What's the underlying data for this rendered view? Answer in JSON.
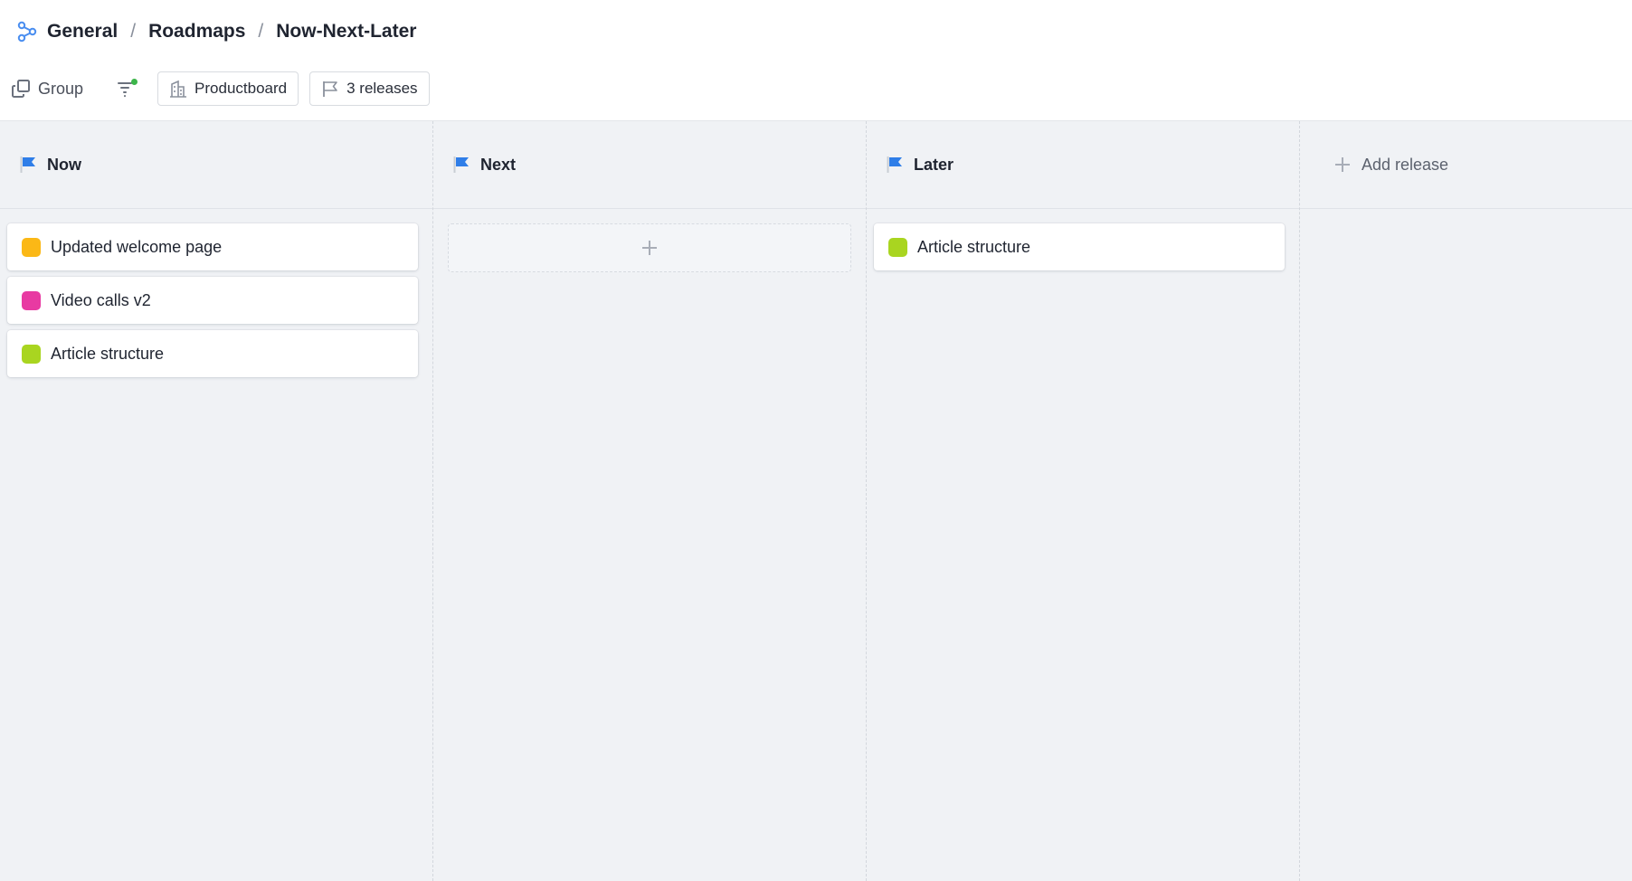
{
  "breadcrumb": {
    "items": [
      "General",
      "Roadmaps",
      "Now-Next-Later"
    ],
    "separator": "/",
    "logo_icon": "hierarchy-icon"
  },
  "toolbar": {
    "group_label": "Group",
    "group_icon": "group-icon",
    "filter_icon": "filter-icon",
    "filter_active_color": "#3cb54a",
    "workspace_label": "Productboard",
    "workspace_icon": "building-icon",
    "releases_label": "3 releases",
    "releases_icon": "flag-outline-icon"
  },
  "colors": {
    "flag": "#2f7ee8",
    "board_bg": "#f0f2f5"
  },
  "columns": [
    {
      "title": "Now",
      "cards": [
        {
          "label": "Updated welcome page",
          "color": "#fbb816"
        },
        {
          "label": "Video calls v2",
          "color": "#e83aa2"
        },
        {
          "label": "Article structure",
          "color": "#a9d520"
        }
      ]
    },
    {
      "title": "Next",
      "cards": []
    },
    {
      "title": "Later",
      "cards": [
        {
          "label": "Article structure",
          "color": "#a9d520"
        }
      ]
    }
  ],
  "add_release_label": "Add release"
}
